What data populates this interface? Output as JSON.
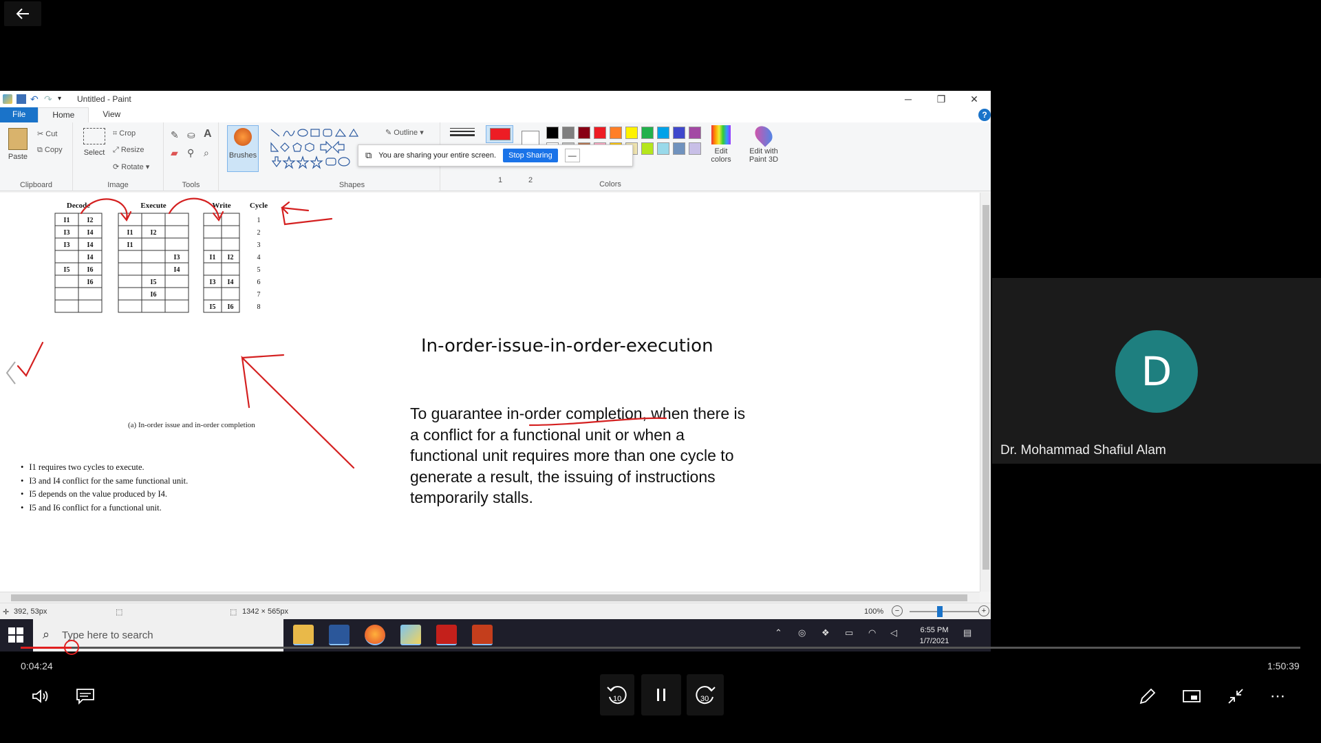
{
  "player": {
    "current_time": "0:04:24",
    "total_time": "1:50:39",
    "progress": 0.04
  },
  "paint": {
    "window_title": "Untitled - Paint",
    "tabs": [
      "File",
      "Home",
      "View"
    ],
    "groups": {
      "clipboard": "Clipboard",
      "image": "Image",
      "tools": "Tools",
      "shapes": "Shapes",
      "colors": "Colors"
    },
    "buttons": {
      "paste": "Paste",
      "cut": "Cut",
      "copy": "Copy",
      "select": "Select",
      "crop": "Crop",
      "resize": "Resize",
      "rotate": "Rotate",
      "brushes": "Brushes",
      "outline": "Outline",
      "size_1": "1",
      "size_2": "2",
      "edit_colors_1": "Edit",
      "edit_colors_2": "colors",
      "edit_paint3d_1": "Edit with",
      "edit_paint3d_2": "Paint 3D"
    },
    "palette": [
      "#000000",
      "#7f7f7f",
      "#880015",
      "#ed1c24",
      "#ff7f27",
      "#fff200",
      "#22b14c",
      "#00a2e8",
      "#3f48cc",
      "#a349a4"
    ],
    "palette_row2": [
      "#ffffff",
      "#c3c3c3",
      "#b97a57",
      "#ffaec9",
      "#ffc90e",
      "#efe4b0",
      "#b5e61d",
      "#99d9ea",
      "#7092be",
      "#c8bfe7"
    ],
    "status": {
      "cursor": "392, 53px",
      "size": "1342 × 565px",
      "zoom": "100%"
    }
  },
  "share_bar": {
    "message": "You are sharing your entire screen.",
    "stop_label": "Stop Sharing",
    "min_label": "—"
  },
  "slide": {
    "title": "In-order-issue-in-order-execution",
    "body": "To guarantee in-order completion, when there is a conflict for a functional unit or when a functional unit requires more than one cycle to generate a result, the issuing of instructions temporarily stalls.",
    "figure": {
      "headers": [
        "Decode",
        "Execute",
        "Write",
        "Cycle"
      ],
      "decode": [
        [
          "I1",
          "I2"
        ],
        [
          "I3",
          "I4"
        ],
        [
          "I3",
          "I4"
        ],
        [
          "",
          "I4"
        ],
        [
          "I5",
          "I6"
        ],
        [
          "",
          "I6"
        ],
        [
          "",
          ""
        ],
        [
          "",
          ""
        ]
      ],
      "execute": [
        [
          "",
          "",
          ""
        ],
        [
          "I1",
          "I2",
          ""
        ],
        [
          "I1",
          "",
          ""
        ],
        [
          "",
          "",
          "I3"
        ],
        [
          "",
          "",
          "I4"
        ],
        [
          "",
          "I5",
          ""
        ],
        [
          "",
          "I6",
          ""
        ],
        [
          "",
          "",
          ""
        ]
      ],
      "write": [
        [
          "",
          ""
        ],
        [
          "",
          ""
        ],
        [
          "",
          ""
        ],
        [
          "I1",
          "I2"
        ],
        [
          "",
          ""
        ],
        [
          "I3",
          "I4"
        ],
        [
          "",
          ""
        ],
        [
          "I5",
          "I6"
        ]
      ],
      "cycles": [
        "1",
        "2",
        "3",
        "4",
        "5",
        "6",
        "7",
        "8"
      ],
      "caption": "(a) In-order issue and in-order completion"
    },
    "bullets": [
      "I1 requires two cycles to execute.",
      "I3 and I4 conflict for the same functional unit.",
      "I5 depends on the value produced by I4.",
      "I5 and I6 conflict for a functional unit."
    ]
  },
  "taskbar": {
    "search_placeholder": "Type here to search",
    "time": "6:55 PM",
    "date": "1/7/2021"
  },
  "participant": {
    "initial": "D",
    "name": "Dr. Mohammad Shafiul Alam",
    "avatar_color": "#1e7f7f"
  }
}
